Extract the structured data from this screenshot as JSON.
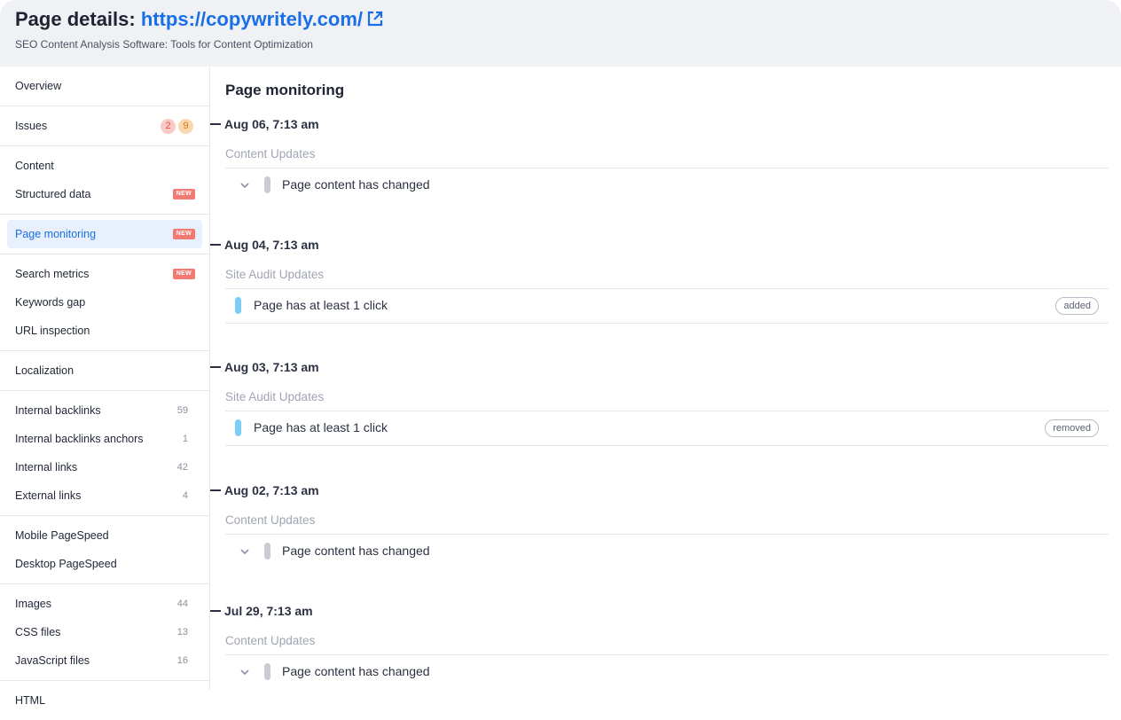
{
  "header": {
    "title_prefix": "Page details:",
    "url": "https://copywritely.com/",
    "subtitle": "SEO Content Analysis Software: Tools for Content Optimization"
  },
  "sidebar": {
    "overview": "Overview",
    "issues": "Issues",
    "issues_red": "2",
    "issues_orange": "9",
    "content": "Content",
    "structured_data": "Structured data",
    "page_monitoring": "Page monitoring",
    "search_metrics": "Search metrics",
    "keywords_gap": "Keywords gap",
    "url_inspection": "URL inspection",
    "localization": "Localization",
    "internal_backlinks": "Internal backlinks",
    "internal_backlinks_count": "59",
    "internal_backlinks_anchors": "Internal backlinks anchors",
    "internal_backlinks_anchors_count": "1",
    "internal_links": "Internal links",
    "internal_links_count": "42",
    "external_links": "External links",
    "external_links_count": "4",
    "mobile_pagespeed": "Mobile PageSpeed",
    "desktop_pagespeed": "Desktop PageSpeed",
    "images": "Images",
    "images_count": "44",
    "css_files": "CSS files",
    "css_files_count": "13",
    "js_files": "JavaScript files",
    "js_files_count": "16",
    "html": "HTML",
    "new_badge": "NEW"
  },
  "main": {
    "title": "Page monitoring",
    "entries": [
      {
        "date": "Aug 06, 7:13 am",
        "type": "Content Updates",
        "text": "Page content has changed"
      },
      {
        "date": "Aug 04, 7:13 am",
        "type": "Site Audit Updates",
        "text": "Page has at least 1 click",
        "tag": "added"
      },
      {
        "date": "Aug 03, 7:13 am",
        "type": "Site Audit Updates",
        "text": "Page has at least 1 click",
        "tag": "removed"
      },
      {
        "date": "Aug 02, 7:13 am",
        "type": "Content Updates",
        "text": "Page content has changed"
      },
      {
        "date": "Jul 29, 7:13 am",
        "type": "Content Updates",
        "text": "Page content has changed"
      }
    ]
  },
  "colors": {
    "accent": "#1a6fe8",
    "new_badge": "#f27a73",
    "active_bg": "#e8f0fd"
  }
}
